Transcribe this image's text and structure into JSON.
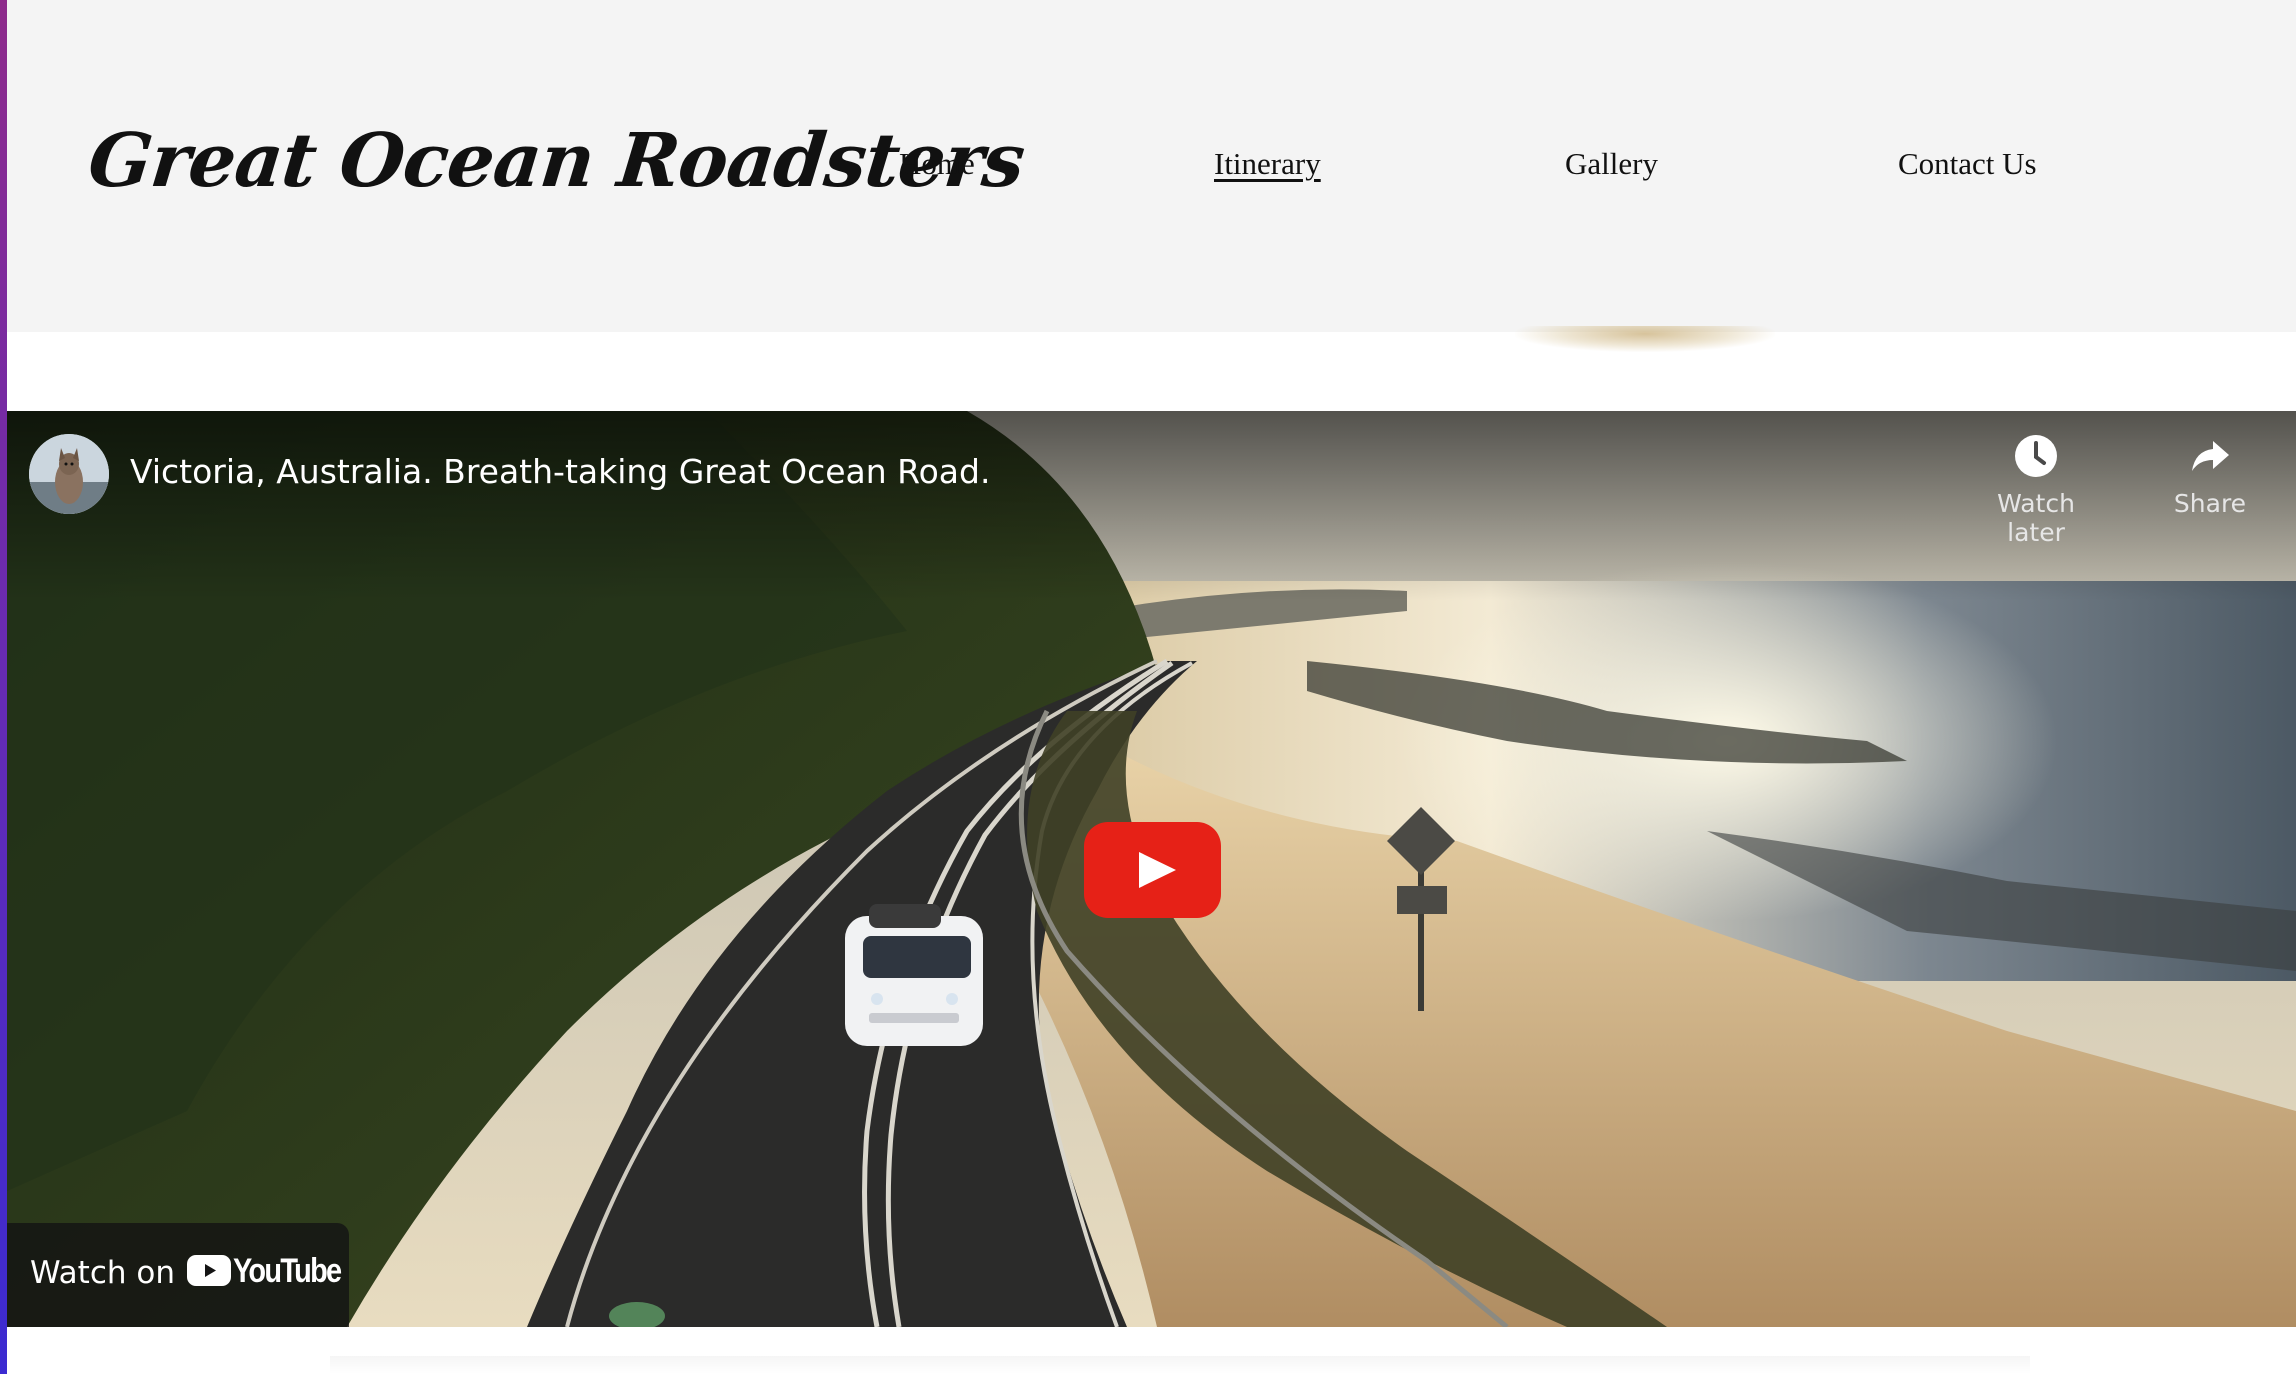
{
  "site": {
    "logo_text": "Great Ocean Roadsters"
  },
  "nav": {
    "items": [
      {
        "label": "Home",
        "active": false
      },
      {
        "label": "Itinerary",
        "active": true
      },
      {
        "label": "Gallery",
        "active": false
      },
      {
        "label": "Contact Us",
        "active": false
      }
    ]
  },
  "video": {
    "title": "Victoria, Australia. Breath-taking Great Ocean Road.",
    "watch_later_label": "Watch later",
    "share_label": "Share",
    "watch_on_label": "Watch on",
    "youtube_wordmark": "YouTube",
    "play_button_color": "#e62117",
    "icons": [
      "channel-avatar",
      "clock-icon",
      "share-arrow-icon",
      "play-icon",
      "youtube-logo-icon"
    ]
  },
  "colors": {
    "header_background": "#f4f4f4",
    "page_background": "#ffffff",
    "edge_bar_gradient": [
      "#8e2a8b",
      "#3b2bd1"
    ]
  }
}
